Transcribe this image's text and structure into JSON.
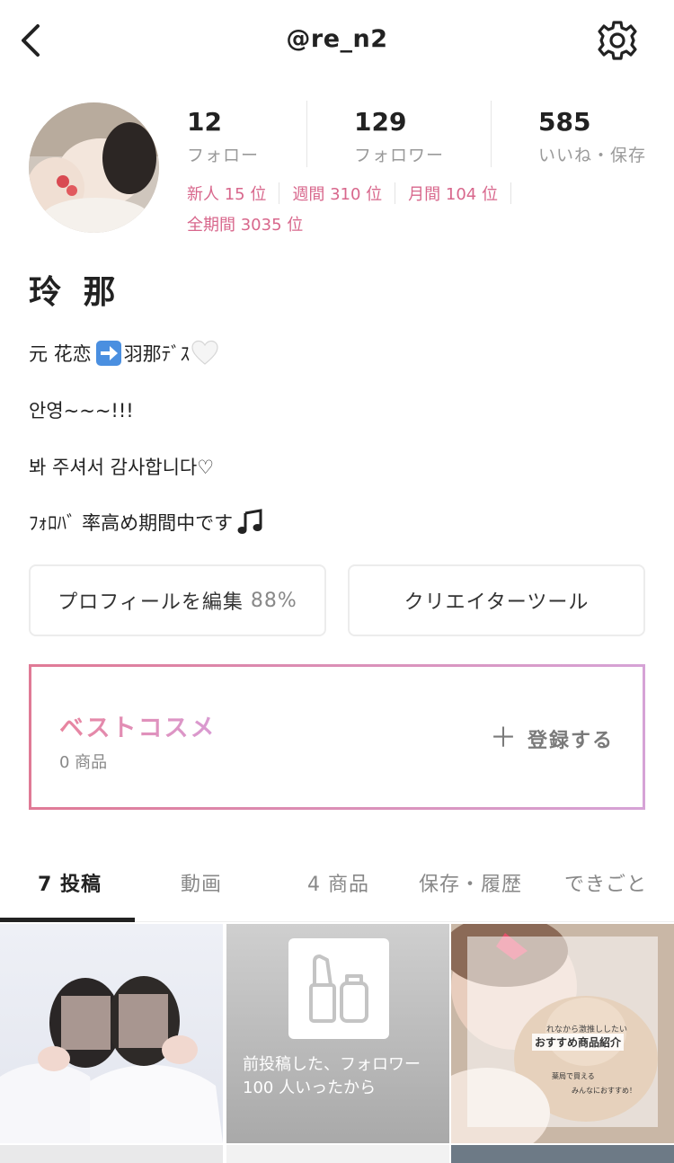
{
  "header": {
    "title": "@re_n2"
  },
  "stats": [
    {
      "count": "12",
      "label": "フォロー"
    },
    {
      "count": "129",
      "label": "フォロワー"
    },
    {
      "count": "585",
      "label": "いいね・保存"
    }
  ],
  "rankings": {
    "row1": [
      {
        "text": "新人 15 位"
      },
      {
        "text": "週間 310 位"
      },
      {
        "text": "月間 104 位"
      }
    ],
    "row2": [
      {
        "text": "全期間 3035 位"
      }
    ]
  },
  "profile": {
    "display_name": "玲 那",
    "bio": {
      "line1_a": "元 花恋",
      "line1_b": "羽那ﾃﾞｽ",
      "line2": "안영~~~!!!",
      "line3": "봐 주셔서 감사합니다♡",
      "line4": "ﾌｫﾛﾊﾞ 率高め期間中です"
    }
  },
  "actions": {
    "edit_profile_label": "プロフィールを編集",
    "edit_profile_percent": "88%",
    "creator_tools_label": "クリエイターツール"
  },
  "best_cosme": {
    "title": "ベストコスメ",
    "count": "0 商品",
    "register_label": "登録する"
  },
  "tabs": [
    {
      "label": "7 投稿",
      "active": true
    },
    {
      "label": "動画"
    },
    {
      "label": "4 商品"
    },
    {
      "label": "保存・履歴"
    },
    {
      "label": "できごと"
    }
  ],
  "posts": [
    {
      "caption": ""
    },
    {
      "caption_line1": "前投稿した、フォロワー",
      "caption_line2": "100 人いったから"
    },
    {
      "overlay_small": "れなから激推ししたい",
      "overlay_title": "おすすめ商品紹介",
      "overlay_note1": "薬局で買える",
      "overlay_note2": "みんなにおすすめ！"
    }
  ],
  "colors": {
    "accent_pink": "#d8678c",
    "text_dark": "#222222",
    "text_gray": "#9a9a9a"
  }
}
